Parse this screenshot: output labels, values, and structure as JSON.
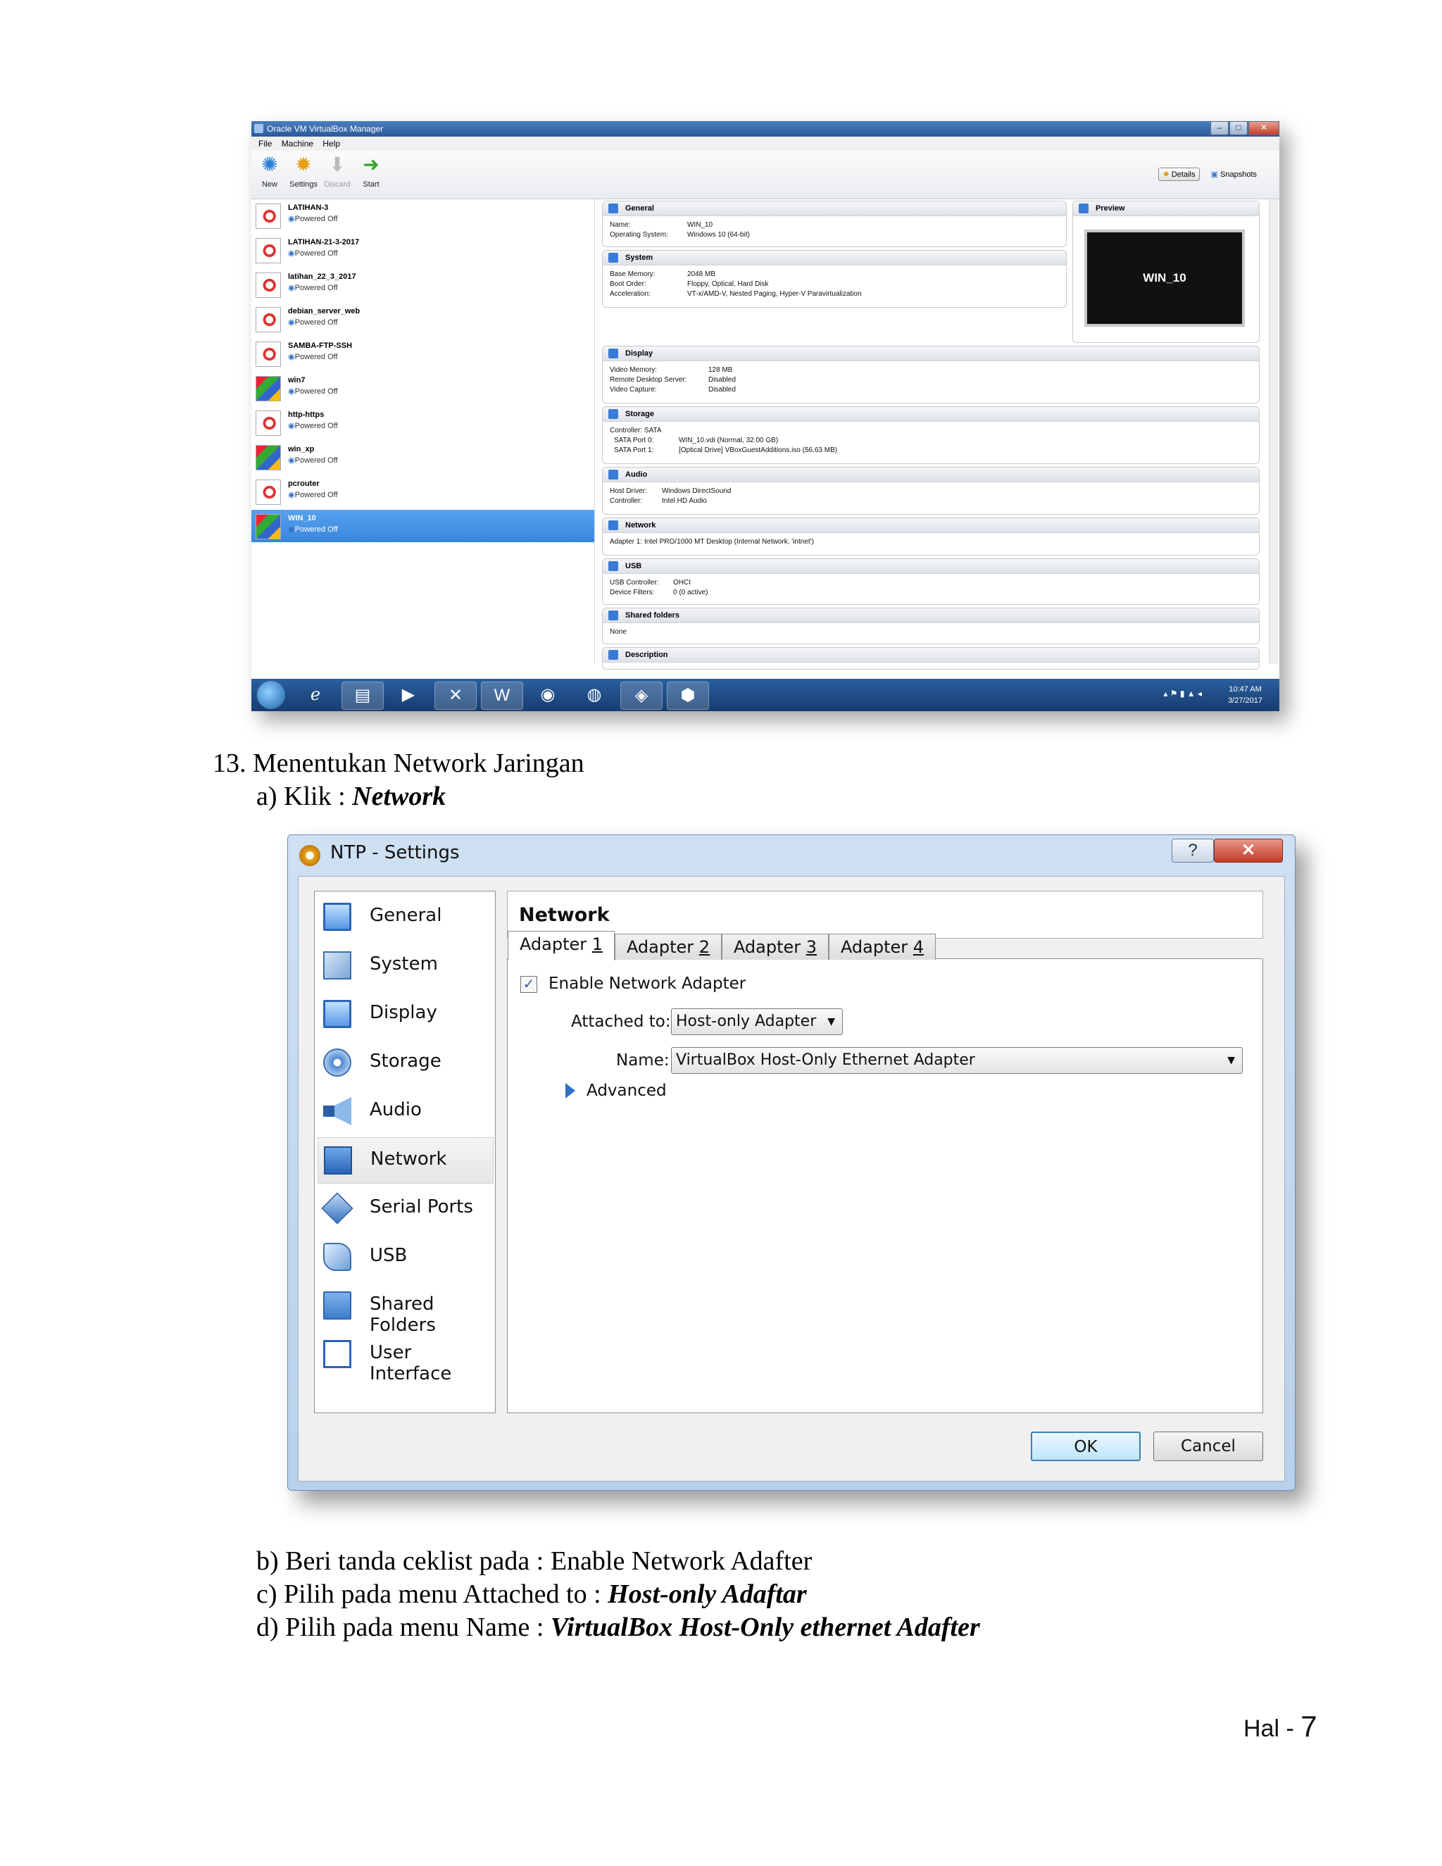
{
  "vbox_manager": {
    "title": "Oracle VM VirtualBox Manager",
    "menu": [
      "File",
      "Machine",
      "Help"
    ],
    "toolbar": {
      "new": "New",
      "settings": "Settings",
      "discard": "Discard",
      "start": "Start"
    },
    "right_tools": {
      "details": "Details",
      "snapshots": "Snapshots"
    },
    "vms": [
      {
        "name": "LATIHAN-3",
        "state": "Powered Off"
      },
      {
        "name": "LATIHAN-21-3-2017",
        "state": "Powered Off"
      },
      {
        "name": "latihan_22_3_2017",
        "state": "Powered Off"
      },
      {
        "name": "debian_server_web",
        "state": "Powered Off"
      },
      {
        "name": "SAMBA-FTP-SSH",
        "state": "Powered Off"
      },
      {
        "name": "win7",
        "state": "Powered Off"
      },
      {
        "name": "http-https",
        "state": "Powered Off"
      },
      {
        "name": "win_xp",
        "state": "Powered Off"
      },
      {
        "name": "pcrouter",
        "state": "Powered Off"
      },
      {
        "name": "WIN_10",
        "state": "Powered Off"
      }
    ],
    "details": {
      "general": {
        "title": "General",
        "name_label": "Name:",
        "name": "WIN_10",
        "os_label": "Operating System:",
        "os": "Windows 10 (64-bit)"
      },
      "system": {
        "title": "System",
        "mem_label": "Base Memory:",
        "mem": "2048 MB",
        "boot_label": "Boot Order:",
        "boot": "Floppy, Optical, Hard Disk",
        "accel_label": "Acceleration:",
        "accel": "VT-x/AMD-V, Nested Paging, Hyper-V Paravirtualization"
      },
      "preview": {
        "title": "Preview",
        "screen": "WIN_10"
      },
      "display": {
        "title": "Display",
        "vmem_label": "Video Memory:",
        "vmem": "128 MB",
        "rds_label": "Remote Desktop Server:",
        "rds": "Disabled",
        "vcap_label": "Video Capture:",
        "vcap": "Disabled"
      },
      "storage": {
        "title": "Storage",
        "controller": "Controller: SATA",
        "p0_label": "SATA Port 0:",
        "p0": "WIN_10.vdi (Normal, 32.00 GB)",
        "p1_label": "SATA Port 1:",
        "p1": "[Optical Drive] VBoxGuestAdditions.iso (56.63 MB)"
      },
      "audio": {
        "title": "Audio",
        "host_label": "Host Driver:",
        "host": "Windows DirectSound",
        "ctrl_label": "Controller:",
        "ctrl": "Intel HD Audio"
      },
      "network": {
        "title": "Network",
        "a1_label": "Adapter 1:",
        "a1": "Intel PRO/1000 MT Desktop (Internal Network, 'intnet')"
      },
      "usb": {
        "title": "USB",
        "ctrl_label": "USB Controller:",
        "ctrl": "OHCI",
        "filt_label": "Device Filters:",
        "filt": "0 (0 active)"
      },
      "shared": {
        "title": "Shared folders",
        "value": "None"
      },
      "description": {
        "title": "Description"
      }
    },
    "taskbar": {
      "time": "10:47 AM",
      "date": "3/27/2017"
    }
  },
  "text": {
    "step13": "13. Menentukan Network Jaringan",
    "step_a_prefix": "a) Klik : ",
    "step_a_bold": "Network",
    "step_b": "b) Beri tanda ceklist pada : Enable Network Adafter",
    "step_c_prefix": "c)  Pilih pada menu Attached to : ",
    "step_c_bold": "Host-only Adaftar",
    "step_d_prefix": "d) Pilih pada menu Name : ",
    "step_d_bold": "VirtualBox Host-Only ethernet Adafter",
    "page_label": "Hal - ",
    "page_number": "7"
  },
  "settings_dialog": {
    "title": "NTP - Settings",
    "help": "?",
    "close": "✕",
    "nav": [
      "General",
      "System",
      "Display",
      "Storage",
      "Audio",
      "Network",
      "Serial Ports",
      "USB",
      "Shared Folders",
      "User Interface"
    ],
    "selected_nav": "Network",
    "pane_title": "Network",
    "tabs": [
      {
        "text": "Adapter ",
        "num": "1"
      },
      {
        "text": "Adapter ",
        "num": "2"
      },
      {
        "text": "Adapter ",
        "num": "3"
      },
      {
        "text": "Adapter ",
        "num": "4"
      }
    ],
    "enable_label": "Enable Network Adapter",
    "enable_checked": true,
    "attached_label": "Attached to:",
    "attached_value": "Host-only Adapter",
    "name_label": "Name:",
    "name_value": "VirtualBox Host-Only Ethernet Adapter",
    "advanced_label": "Advanced",
    "ok": "OK",
    "cancel": "Cancel"
  }
}
